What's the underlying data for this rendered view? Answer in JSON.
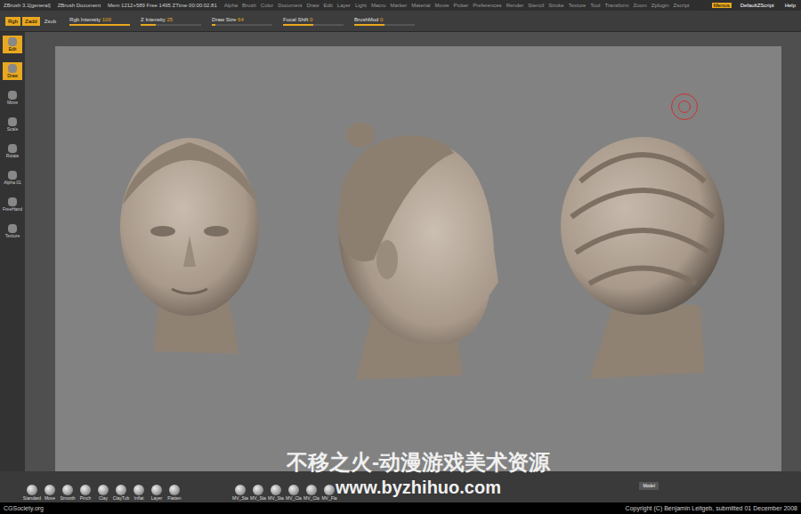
{
  "window": {
    "title": "ZBrush 3.1[general]",
    "document": "ZBrush Document",
    "status": "Mem 1212+589 Free 1495 ZTime 00:00:02.81"
  },
  "menus": [
    "Alpha",
    "Brush",
    "Color",
    "Document",
    "Draw",
    "Edit",
    "Layer",
    "Light",
    "Macro",
    "Marker",
    "Material",
    "Movie",
    "Picker",
    "Preferences",
    "Render",
    "Stencil",
    "Stroke",
    "Texture",
    "Tool",
    "Transform",
    "Zoom",
    "Zplugin",
    "Zscript"
  ],
  "right_menus": [
    {
      "label": "Menus",
      "selected": true
    },
    {
      "label": "DefaultZScript",
      "selected": false
    },
    {
      "label": "Help",
      "selected": false
    }
  ],
  "toolbar": {
    "modes": [
      {
        "label": "Rgb",
        "selected": true
      },
      {
        "label": "Zadd",
        "selected": true
      },
      {
        "label": "Zsub",
        "selected": false
      }
    ],
    "sliders": [
      {
        "label": "Rgb Intensity",
        "value": "100",
        "level": 1
      },
      {
        "label": "Z Intensity",
        "value": "25",
        "level": 0.25
      },
      {
        "label": "Draw Size",
        "value": "64",
        "level": 0.06
      },
      {
        "label": "Focal Shift",
        "value": "0",
        "level": 0.5
      },
      {
        "label": "BrushMod",
        "value": "0",
        "level": 0.5
      }
    ]
  },
  "shelf": [
    {
      "label": "Edit",
      "selected": true
    },
    {
      "label": "Draw",
      "selected": true
    },
    {
      "label": "Move",
      "selected": false
    },
    {
      "label": "Scale",
      "selected": false
    },
    {
      "label": "Rotate",
      "selected": false
    },
    {
      "label": "Alpha 01",
      "selected": false
    },
    {
      "label": "FreeHand",
      "selected": false
    },
    {
      "label": "Texture",
      "selected": false
    }
  ],
  "brushes": [
    "Standard",
    "Move",
    "Smooth",
    "Pinch",
    "Clay",
    "ClayTub",
    "Inflat",
    "Layer",
    "Flatten"
  ],
  "custom_brushes": [
    "MV_Sta",
    "MV_Sta",
    "MV_Sta",
    "MV_Cla",
    "MV_Cla",
    "MV_Fla"
  ],
  "bottom_buttons": [
    "Model"
  ],
  "watermark": {
    "line1": "不移之火-动漫游戏美术资源",
    "line2": "www.byzhihuo.com"
  },
  "footer": {
    "left": "CGSociety.org",
    "right": "Copyright (C) Benjamin Leitgeb, submitted 01 December 2008"
  }
}
